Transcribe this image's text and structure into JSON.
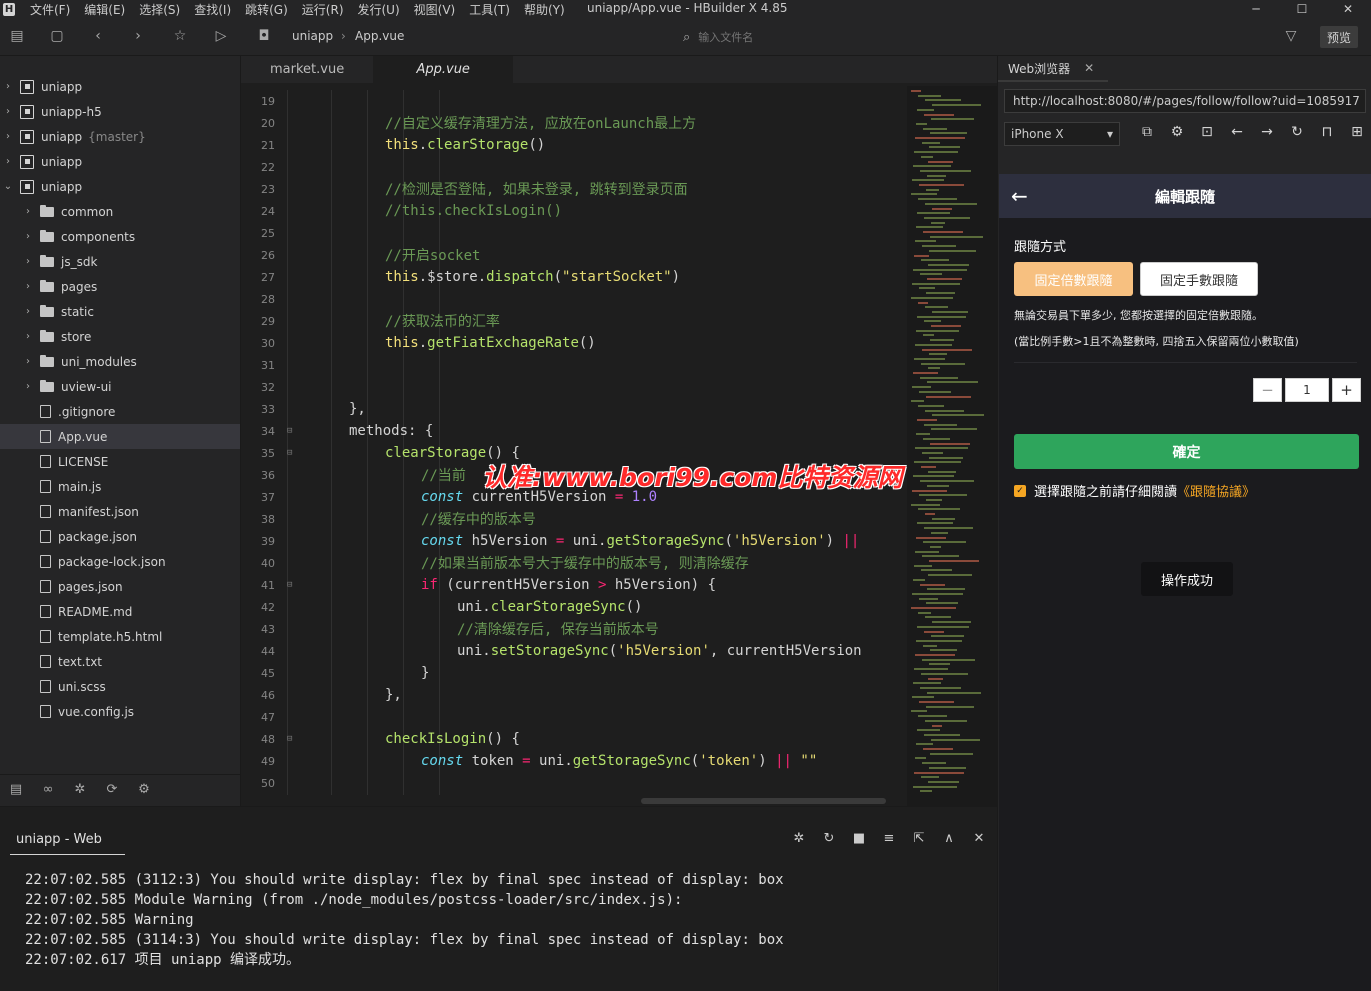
{
  "app": {
    "title": "uniapp/App.vue - HBuilder X 4.85",
    "menu": [
      "文件(F)",
      "编辑(E)",
      "选择(S)",
      "查找(I)",
      "跳转(G)",
      "运行(R)",
      "发行(U)",
      "视图(V)",
      "工具(T)",
      "帮助(Y)"
    ]
  },
  "toolbar": {
    "breadcrumb": [
      "uniapp",
      "App.vue"
    ],
    "file_search_placeholder": "输入文件名",
    "preview_label": "预览"
  },
  "sidebar": {
    "items": [
      {
        "label": "uniapp",
        "type": "project",
        "level": 0,
        "expanded": false
      },
      {
        "label": "uniapp-h5",
        "type": "project",
        "level": 0,
        "expanded": false
      },
      {
        "label": "uniapp",
        "branch": "{master}",
        "type": "project",
        "level": 0,
        "expanded": false
      },
      {
        "label": "uniapp",
        "type": "project",
        "level": 0,
        "expanded": false
      },
      {
        "label": "uniapp",
        "type": "project",
        "level": 0,
        "expanded": true
      },
      {
        "label": "common",
        "type": "folder",
        "level": 1
      },
      {
        "label": "components",
        "type": "folder",
        "level": 1
      },
      {
        "label": "js_sdk",
        "type": "folder",
        "level": 1
      },
      {
        "label": "pages",
        "type": "folder",
        "level": 1
      },
      {
        "label": "static",
        "type": "folder",
        "level": 1
      },
      {
        "label": "store",
        "type": "folder",
        "level": 1
      },
      {
        "label": "uni_modules",
        "type": "folder",
        "level": 1
      },
      {
        "label": "uview-ui",
        "type": "folder",
        "level": 1
      },
      {
        "label": ".gitignore",
        "type": "file",
        "level": 1
      },
      {
        "label": "App.vue",
        "type": "file",
        "level": 1,
        "selected": true
      },
      {
        "label": "LICENSE",
        "type": "file",
        "level": 1
      },
      {
        "label": "main.js",
        "type": "file",
        "level": 1
      },
      {
        "label": "manifest.json",
        "type": "file",
        "level": 1
      },
      {
        "label": "package.json",
        "type": "file",
        "level": 1
      },
      {
        "label": "package-lock.json",
        "type": "file",
        "level": 1
      },
      {
        "label": "pages.json",
        "type": "file",
        "level": 1
      },
      {
        "label": "README.md",
        "type": "file",
        "level": 1
      },
      {
        "label": "template.h5.html",
        "type": "file",
        "level": 1
      },
      {
        "label": "text.txt",
        "type": "file",
        "level": 1
      },
      {
        "label": "uni.scss",
        "type": "file",
        "level": 1
      },
      {
        "label": "vue.config.js",
        "type": "file",
        "level": 1
      }
    ]
  },
  "editor": {
    "tabs": [
      {
        "label": "market.vue",
        "active": false
      },
      {
        "label": "App.vue",
        "active": true
      }
    ],
    "lines": [
      {
        "n": "19",
        "indent": 0,
        "tokens": []
      },
      {
        "n": "20",
        "indent": 4,
        "tokens": [
          [
            "cm",
            "//自定义缓存清理方法, 应放在onLaunch最上方"
          ]
        ]
      },
      {
        "n": "21",
        "indent": 4,
        "tokens": [
          [
            "kw",
            "this"
          ],
          [
            "pl",
            "."
          ],
          [
            "fn",
            "clearStorage"
          ],
          [
            "pl",
            "()"
          ]
        ]
      },
      {
        "n": "22",
        "indent": 0,
        "tokens": []
      },
      {
        "n": "23",
        "indent": 4,
        "tokens": [
          [
            "cm",
            "//检测是否登陆, 如果未登录, 跳转到登录页面"
          ]
        ]
      },
      {
        "n": "24",
        "indent": 4,
        "tokens": [
          [
            "cm",
            "//this.checkIsLogin()"
          ]
        ]
      },
      {
        "n": "25",
        "indent": 0,
        "tokens": []
      },
      {
        "n": "26",
        "indent": 4,
        "tokens": [
          [
            "cm",
            "//开启socket"
          ]
        ]
      },
      {
        "n": "27",
        "indent": 4,
        "tokens": [
          [
            "kw",
            "this"
          ],
          [
            "pl",
            ".$store."
          ],
          [
            "fn",
            "dispatch"
          ],
          [
            "pl",
            "("
          ],
          [
            "str",
            "\"startSocket\""
          ],
          [
            "pl",
            ")"
          ]
        ]
      },
      {
        "n": "28",
        "indent": 0,
        "tokens": []
      },
      {
        "n": "29",
        "indent": 4,
        "tokens": [
          [
            "cm",
            "//获取法币的汇率"
          ]
        ]
      },
      {
        "n": "30",
        "indent": 4,
        "tokens": [
          [
            "kw",
            "this"
          ],
          [
            "pl",
            "."
          ],
          [
            "fn",
            "getFiatExchageRate"
          ],
          [
            "pl",
            "()"
          ]
        ]
      },
      {
        "n": "31",
        "indent": 0,
        "tokens": []
      },
      {
        "n": "32",
        "indent": 0,
        "tokens": []
      },
      {
        "n": "33",
        "indent": 2,
        "tokens": [
          [
            "pl",
            "},"
          ]
        ]
      },
      {
        "n": "34",
        "indent": 2,
        "fold": true,
        "tokens": [
          [
            "pl",
            "methods: {"
          ]
        ]
      },
      {
        "n": "35",
        "indent": 4,
        "fold": true,
        "tokens": [
          [
            "fn",
            "clearStorage"
          ],
          [
            "pl",
            "() {"
          ]
        ]
      },
      {
        "n": "36",
        "indent": 6,
        "tokens": [
          [
            "cm",
            "//当前"
          ]
        ]
      },
      {
        "n": "37",
        "indent": 6,
        "tokens": [
          [
            "ty",
            "const"
          ],
          [
            "pl",
            " currentH5Version "
          ],
          [
            "op",
            "="
          ],
          [
            "pl",
            " "
          ],
          [
            "num",
            "1.0"
          ]
        ]
      },
      {
        "n": "38",
        "indent": 6,
        "tokens": [
          [
            "cm",
            "//缓存中的版本号"
          ]
        ]
      },
      {
        "n": "39",
        "indent": 6,
        "tokens": [
          [
            "ty",
            "const"
          ],
          [
            "pl",
            " h5Version "
          ],
          [
            "op",
            "="
          ],
          [
            "pl",
            " uni."
          ],
          [
            "fn",
            "getStorageSync"
          ],
          [
            "pl",
            "("
          ],
          [
            "str",
            "'h5Version'"
          ],
          [
            "pl",
            ") "
          ],
          [
            "op",
            "||"
          ]
        ]
      },
      {
        "n": "40",
        "indent": 6,
        "tokens": [
          [
            "cm",
            "//如果当前版本号大于缓存中的版本号, 则清除缓存"
          ]
        ]
      },
      {
        "n": "41",
        "indent": 6,
        "fold": true,
        "tokens": [
          [
            "op",
            "if"
          ],
          [
            "pl",
            " (currentH5Version "
          ],
          [
            "op",
            ">"
          ],
          [
            "pl",
            " h5Version) {"
          ]
        ]
      },
      {
        "n": "42",
        "indent": 8,
        "tokens": [
          [
            "pl",
            "uni."
          ],
          [
            "fn",
            "clearStorageSync"
          ],
          [
            "pl",
            "()"
          ]
        ]
      },
      {
        "n": "43",
        "indent": 8,
        "tokens": [
          [
            "cm",
            "//清除缓存后, 保存当前版本号"
          ]
        ]
      },
      {
        "n": "44",
        "indent": 8,
        "tokens": [
          [
            "pl",
            "uni."
          ],
          [
            "fn",
            "setStorageSync"
          ],
          [
            "pl",
            "("
          ],
          [
            "str",
            "'h5Version'"
          ],
          [
            "pl",
            ", currentH5Version"
          ]
        ]
      },
      {
        "n": "45",
        "indent": 6,
        "tokens": [
          [
            "pl",
            "}"
          ]
        ]
      },
      {
        "n": "46",
        "indent": 4,
        "tokens": [
          [
            "pl",
            "},"
          ]
        ]
      },
      {
        "n": "47",
        "indent": 0,
        "tokens": []
      },
      {
        "n": "48",
        "indent": 4,
        "fold": true,
        "tokens": [
          [
            "fn",
            "checkIsLogin"
          ],
          [
            "pl",
            "() {"
          ]
        ]
      },
      {
        "n": "49",
        "indent": 6,
        "tokens": [
          [
            "ty",
            "const"
          ],
          [
            "pl",
            " token "
          ],
          [
            "op",
            "="
          ],
          [
            "pl",
            " uni."
          ],
          [
            "fn",
            "getStorageSync"
          ],
          [
            "pl",
            "("
          ],
          [
            "str",
            "'token'"
          ],
          [
            "pl",
            ") "
          ],
          [
            "op",
            "||"
          ],
          [
            "pl",
            " "
          ],
          [
            "str",
            "\"\""
          ]
        ]
      },
      {
        "n": "50",
        "indent": 0,
        "tokens": []
      }
    ]
  },
  "browser": {
    "tab_label": "Web浏览器",
    "url": "http://localhost:8080/#/pages/follow/follow?uid=1085917",
    "device": "iPhone X",
    "phone": {
      "nav_title": "編輯跟隨",
      "section_label": "跟隨方式",
      "option_multiple": "固定倍數跟隨",
      "option_lots": "固定手數跟隨",
      "note1": "無論交易員下單多少, 您都按選擇的固定倍數跟隨。",
      "note2": "(當比例手數>1且不為整數時, 四捨五入保留兩位小數取值)",
      "stepper_minus": "−",
      "stepper_value": "1",
      "stepper_plus": "+",
      "confirm_label": "確定",
      "agree_prefix": "選擇跟隨之前請仔細閱讀",
      "agree_link": "《跟隨協議》",
      "toast": "操作成功"
    }
  },
  "console": {
    "tab_label": "uniapp - Web",
    "logs": [
      "22:07:02.585 (3112:3) You should write display: flex by final spec instead of display: box",
      "22:07:02.585 Module Warning (from ./node_modules/postcss-loader/src/index.js):",
      "22:07:02.585 Warning",
      "22:07:02.585 (3114:3) You should write display: flex by final spec instead of display: box",
      "22:07:02.617 项目 uniapp 编译成功。"
    ]
  },
  "watermark": "认准:www.bori99.com比特资源网"
}
